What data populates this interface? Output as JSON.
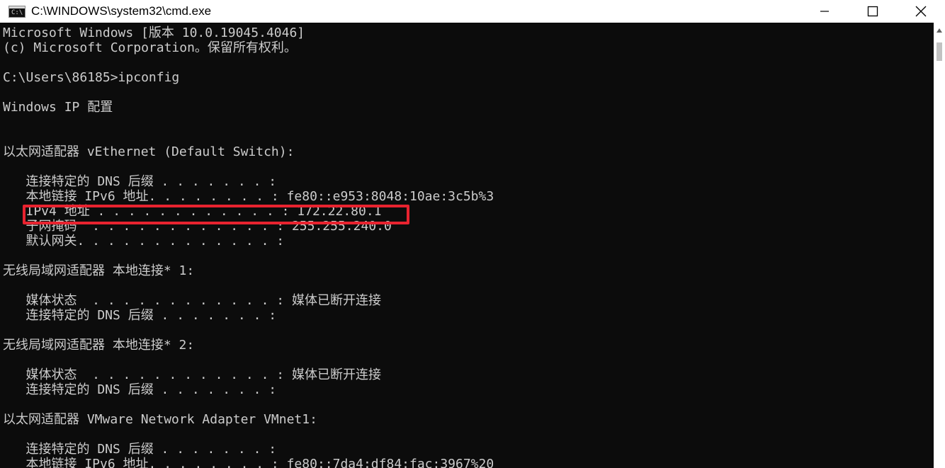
{
  "window": {
    "title": "C:\\WINDOWS\\system32\\cmd.exe",
    "icon_text": "C:\\"
  },
  "console": {
    "lines": [
      "Microsoft Windows [版本 10.0.19045.4046]",
      "(c) Microsoft Corporation。保留所有权利。",
      "",
      "C:\\Users\\86185>ipconfig",
      "",
      "Windows IP 配置",
      "",
      "",
      "以太网适配器 vEthernet (Default Switch):",
      "",
      "   连接特定的 DNS 后缀 . . . . . . . :",
      "   本地链接 IPv6 地址. . . . . . . . : fe80::e953:8048:10ae:3c5b%3",
      "   IPv4 地址 . . . . . . . . . . . . : 172.22.80.1",
      "   子网掩码  . . . . . . . . . . . . : 255.255.240.0",
      "   默认网关. . . . . . . . . . . . . :",
      "",
      "无线局域网适配器 本地连接* 1:",
      "",
      "   媒体状态  . . . . . . . . . . . . : 媒体已断开连接",
      "   连接特定的 DNS 后缀 . . . . . . . :",
      "",
      "无线局域网适配器 本地连接* 2:",
      "",
      "   媒体状态  . . . . . . . . . . . . : 媒体已断开连接",
      "   连接特定的 DNS 后缀 . . . . . . . :",
      "",
      "以太网适配器 VMware Network Adapter VMnet1:",
      "",
      "   连接特定的 DNS 后缀 . . . . . . . :",
      "   本地链接 IPv6 地址. . . . . . . . : fe80::7da4:df84:fac:3967%20"
    ]
  },
  "colors": {
    "console_bg": "#0c0c0c",
    "console_text": "#cccccc",
    "highlight": "#e8232f"
  }
}
